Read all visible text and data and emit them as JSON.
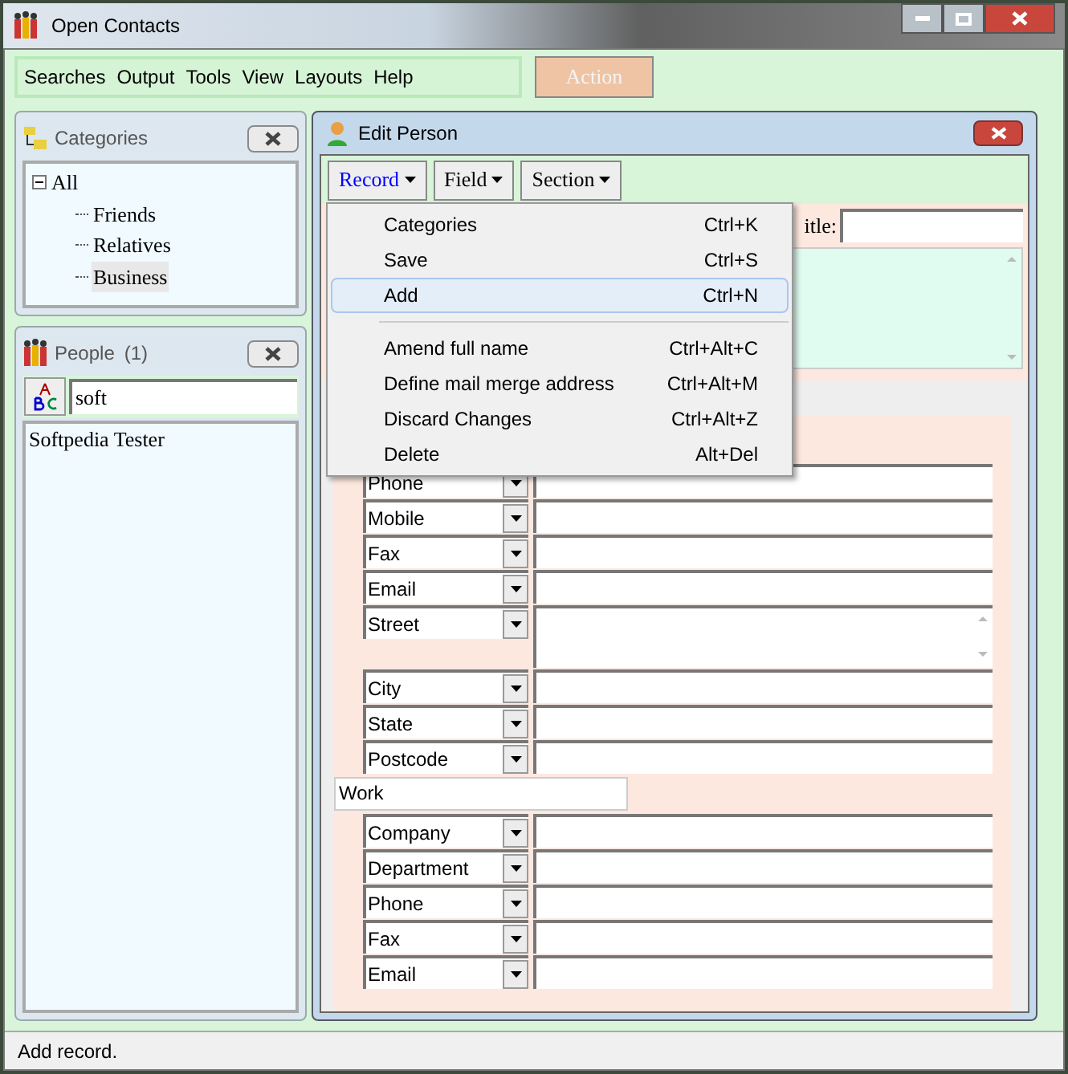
{
  "window": {
    "title": "Open Contacts"
  },
  "menu": [
    "Searches",
    "Output",
    "Tools",
    "View",
    "Layouts",
    "Help"
  ],
  "action_button": {
    "label": "Action",
    "disabled": true
  },
  "categories": {
    "title": "Categories",
    "tree": [
      {
        "label": "All",
        "expanded": true,
        "selected": false,
        "children": [
          {
            "label": "Friends",
            "selected": false
          },
          {
            "label": "Relatives",
            "selected": false
          },
          {
            "label": "Business",
            "selected": true
          }
        ]
      }
    ]
  },
  "people": {
    "title": "People",
    "count": "(1)",
    "search": {
      "value": "soft"
    },
    "items": [
      {
        "label": "Softpedia Tester",
        "selected": false
      }
    ]
  },
  "edit_person": {
    "title": "Edit Person",
    "toolbar": [
      {
        "label": "Record",
        "selected": true
      },
      {
        "label": "Field",
        "selected": false
      },
      {
        "label": "Section",
        "selected": false
      }
    ],
    "record_menu": [
      {
        "kind": "item",
        "label": "Categories",
        "shortcut": "Ctrl+K",
        "selected": false
      },
      {
        "kind": "item",
        "label": "Save",
        "shortcut": "Ctrl+S",
        "selected": false
      },
      {
        "kind": "item",
        "label": "Add",
        "shortcut": "Ctrl+N",
        "selected": true
      },
      {
        "kind": "separator"
      },
      {
        "kind": "item",
        "label": "Amend full name",
        "shortcut": "Ctrl+Alt+C",
        "selected": false
      },
      {
        "kind": "item",
        "label": "Define mail merge address",
        "shortcut": "Ctrl+Alt+M",
        "selected": false
      },
      {
        "kind": "item",
        "label": "Discard Changes",
        "shortcut": "Ctrl+Alt+Z",
        "selected": false
      },
      {
        "kind": "item",
        "label": "Delete",
        "shortcut": "Alt+Del",
        "selected": false
      }
    ],
    "title_field": {
      "label": "itle:"
    },
    "sections": [
      {
        "fields": [
          {
            "label": "Phone",
            "kind": "line"
          },
          {
            "label": "Mobile",
            "kind": "line"
          },
          {
            "label": "Fax",
            "kind": "line"
          },
          {
            "label": "Email",
            "kind": "line"
          },
          {
            "label": "Street",
            "kind": "multiline"
          },
          {
            "label": "City",
            "kind": "line"
          },
          {
            "label": "State",
            "kind": "line"
          },
          {
            "label": "Postcode",
            "kind": "line"
          }
        ]
      },
      {
        "heading": "Work",
        "fields": [
          {
            "label": "Company",
            "kind": "line"
          },
          {
            "label": "Department",
            "kind": "line"
          },
          {
            "label": "Phone",
            "kind": "line"
          },
          {
            "label": "Fax",
            "kind": "line"
          },
          {
            "label": "Email",
            "kind": "line"
          }
        ]
      }
    ]
  },
  "status_bar": "Add record."
}
